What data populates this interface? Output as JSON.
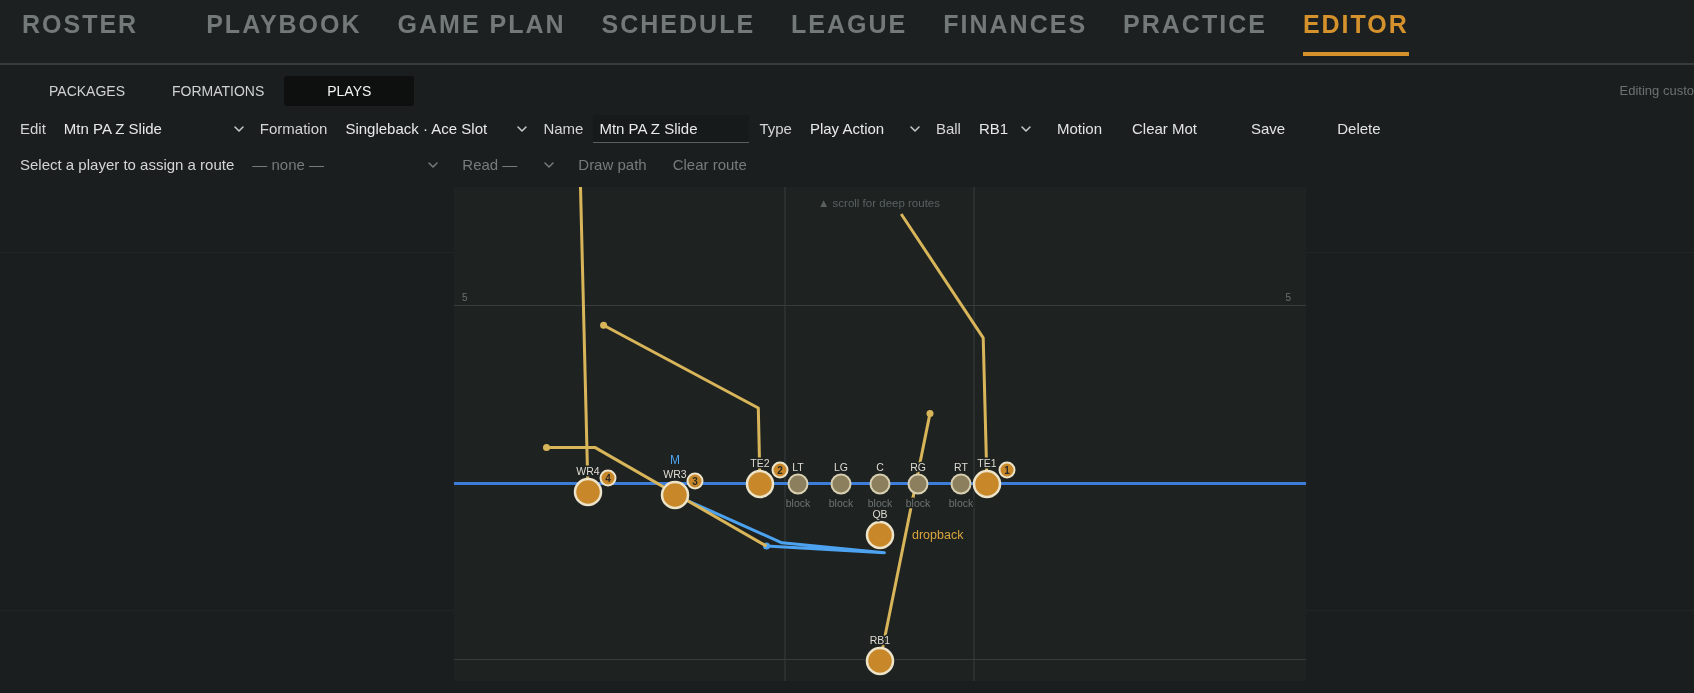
{
  "nav": [
    {
      "label": "ROSTER",
      "selected": false
    },
    {
      "label": "PLAYBOOK",
      "selected": false
    },
    {
      "label": "GAME PLAN",
      "selected": false
    },
    {
      "label": "SCHEDULE",
      "selected": false
    },
    {
      "label": "LEAGUE",
      "selected": false
    },
    {
      "label": "FINANCES",
      "selected": false
    },
    {
      "label": "PRACTICE",
      "selected": false
    },
    {
      "label": "EDITOR",
      "selected": true
    }
  ],
  "subtabs": [
    {
      "label": "PACKAGES",
      "selected": false
    },
    {
      "label": "FORMATIONS",
      "selected": false
    },
    {
      "label": "PLAYS",
      "selected": true
    }
  ],
  "status_text": "Editing custo",
  "toolbar": [
    {
      "kind": "label",
      "text": "Edit"
    },
    {
      "kind": "select",
      "value": "Mtn PA Z Slide",
      "disabled": false
    },
    {
      "kind": "label",
      "text": "Formation"
    },
    {
      "kind": "select",
      "value": "Singleback · Ace Slot",
      "disabled": false
    },
    {
      "kind": "label",
      "text": "Name"
    },
    {
      "kind": "input",
      "value": "Mtn PA Z Slide",
      "disabled": false
    },
    {
      "kind": "label",
      "text": "Type"
    },
    {
      "kind": "select",
      "value": "Play Action",
      "disabled": false
    },
    {
      "kind": "label",
      "text": "Ball"
    },
    {
      "kind": "select",
      "value": "RB1",
      "disabled": false
    },
    {
      "kind": "button",
      "text": "Motion",
      "disabled": false
    },
    {
      "kind": "button",
      "text": "Clear Mot",
      "disabled": false
    },
    {
      "kind": "button",
      "text": "Save",
      "disabled": false
    },
    {
      "kind": "button",
      "text": "Delete",
      "disabled": false
    }
  ],
  "route_bar": [
    {
      "kind": "label",
      "text": "Select a player to assign a route"
    },
    {
      "kind": "select",
      "value": "— none —",
      "disabled": true
    },
    {
      "kind": "select",
      "value": "Read —",
      "disabled": true
    },
    {
      "kind": "button",
      "text": "Draw path",
      "disabled": true
    },
    {
      "kind": "button",
      "text": "Clear route",
      "disabled": true
    }
  ],
  "field": {
    "scroll_hint": "▲ scroll for deep routes",
    "yard_numbers": [
      "5",
      "5"
    ],
    "players": [
      {
        "label": "WR4",
        "kind": "skill",
        "read_order": "4",
        "selected": false
      },
      {
        "label": "WR3",
        "kind": "skill",
        "read_order": "3",
        "motion": "M",
        "selected": false
      },
      {
        "label": "TE2",
        "kind": "skill",
        "read_order": "2",
        "selected": false
      },
      {
        "label": "LT",
        "kind": "lineman",
        "assignment": "block",
        "selected": false
      },
      {
        "label": "LG",
        "kind": "lineman",
        "assignment": "block",
        "selected": false
      },
      {
        "label": "C",
        "kind": "lineman",
        "assignment": "block",
        "selected": false
      },
      {
        "label": "RG",
        "kind": "lineman",
        "assignment": "block",
        "selected": false
      },
      {
        "label": "RT",
        "kind": "lineman",
        "assignment": "block",
        "selected": false
      },
      {
        "label": "TE1",
        "kind": "skill",
        "read_order": "1",
        "selected": false
      },
      {
        "label": "QB",
        "kind": "skill",
        "assignment": "dropback",
        "selected": false
      },
      {
        "label": "RB1",
        "kind": "skill",
        "selected": false
      }
    ]
  }
}
